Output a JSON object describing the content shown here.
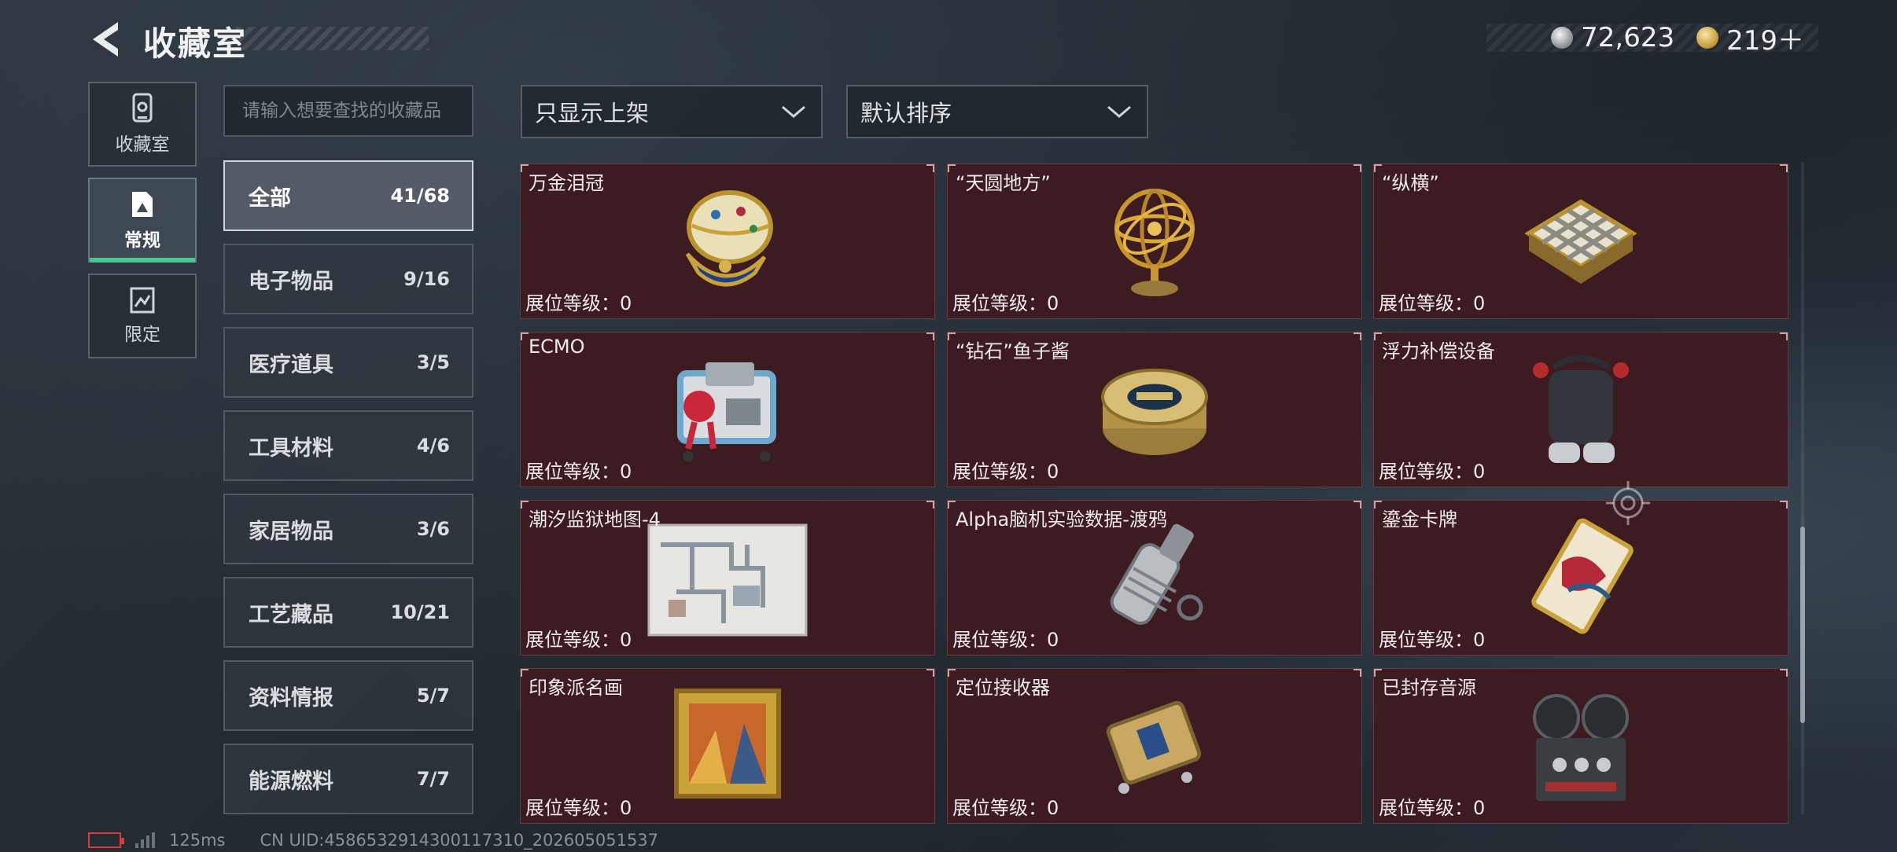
{
  "header": {
    "title": "收藏室",
    "currencies": [
      {
        "icon": "silver-coin-icon",
        "value": "72,623"
      },
      {
        "icon": "gold-coin-icon",
        "value": "219＋"
      }
    ]
  },
  "nav_tabs": [
    {
      "label": "收藏室",
      "icon": "trophy-case-icon",
      "active": false
    },
    {
      "label": "常规",
      "icon": "picture-frame-icon",
      "active": true
    },
    {
      "label": "限定",
      "icon": "limited-frame-icon",
      "active": false
    }
  ],
  "search": {
    "placeholder": "请输入想要查找的收藏品"
  },
  "categories": [
    {
      "name": "全部",
      "count": "41/68",
      "active": true
    },
    {
      "name": "电子物品",
      "count": "9/16"
    },
    {
      "name": "医疗道具",
      "count": "3/5"
    },
    {
      "name": "工具材料",
      "count": "4/6"
    },
    {
      "name": "家居物品",
      "count": "3/6"
    },
    {
      "name": "工艺藏品",
      "count": "10/21"
    },
    {
      "name": "资料情报",
      "count": "5/7"
    },
    {
      "name": "能源燃料",
      "count": "7/7"
    }
  ],
  "filters": {
    "display_filter": "只显示上架",
    "sort_order": "默认排序"
  },
  "level_label": "展位等级：0",
  "items": [
    {
      "name": "万金泪冠",
      "icon": "jeweled-egg-icon"
    },
    {
      "name": "“天圆地方”",
      "icon": "armillary-sphere-icon"
    },
    {
      "name": "“纵横”",
      "icon": "chess-board-icon"
    },
    {
      "name": "ECMO",
      "icon": "ecmo-machine-icon"
    },
    {
      "name": "“钻石”鱼子酱",
      "icon": "caviar-tin-icon"
    },
    {
      "name": "浮力补偿设备",
      "icon": "buoyancy-device-icon"
    },
    {
      "name": "潮汐监狱地图-4",
      "icon": "map-icon"
    },
    {
      "name": "Alpha脑机实验数据-渡鸦",
      "icon": "data-drive-icon"
    },
    {
      "name": "鎏金卡牌",
      "icon": "gilded-card-icon"
    },
    {
      "name": "印象派名画",
      "icon": "framed-painting-icon"
    },
    {
      "name": "定位接收器",
      "icon": "locator-receiver-icon"
    },
    {
      "name": "已封存音源",
      "icon": "reel-recorder-icon"
    }
  ],
  "status_bar": {
    "ping": "125ms",
    "uid": "CN UID:4586532914300117310_202605051537"
  },
  "colors": {
    "accent_green": "#45c98f",
    "card_bg": "#3c1c20",
    "battery_red": "#d93b3b"
  }
}
